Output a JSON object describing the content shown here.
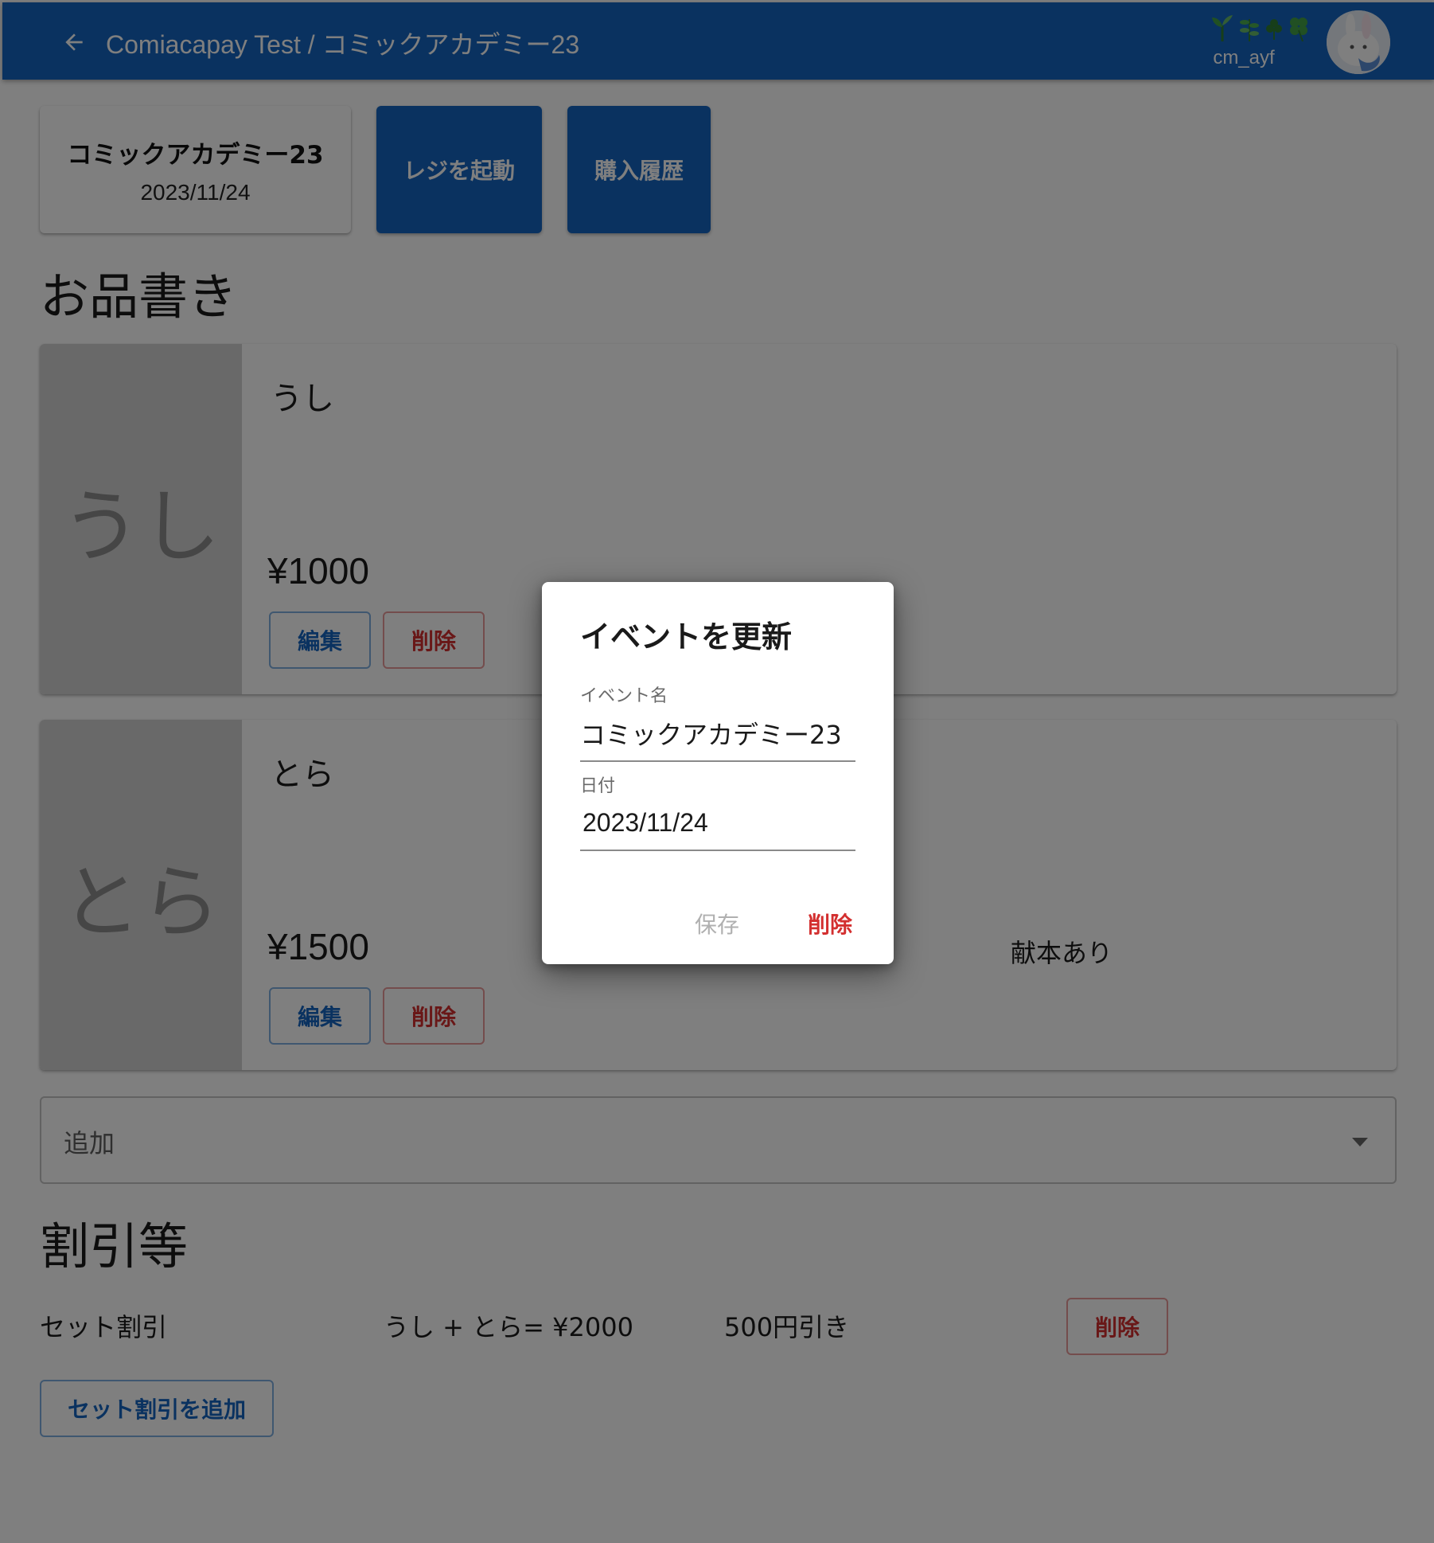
{
  "appbar": {
    "title": "Comiacapay Test / コミックアカデミー23",
    "user_emoji": "🌱🌿☘🍀",
    "username": "cm_ayf",
    "icons": [
      "arrow-left-icon",
      "avatar"
    ]
  },
  "event": {
    "name": "コミックアカデミー23",
    "date": "2023/11/24"
  },
  "actions": {
    "register_label": "レジを起動",
    "history_label": "購入履歴"
  },
  "menu": {
    "title": "お品書き",
    "items": [
      {
        "thumb_text": "うし",
        "name": "うし",
        "price": "¥1000",
        "note": "",
        "edit_label": "編集",
        "delete_label": "削除"
      },
      {
        "thumb_text": "とら",
        "name": "とら",
        "price": "¥1500",
        "note": "献本あり",
        "edit_label": "編集",
        "delete_label": "削除"
      }
    ],
    "add_select_label": "追加"
  },
  "discounts": {
    "title": "割引等",
    "rows": [
      {
        "type": "セット割引",
        "items": "うし + とら= ¥2000",
        "amount": "500円引き",
        "delete_label": "削除"
      }
    ],
    "add_set_label": "セット割引を追加"
  },
  "dialog": {
    "title": "イベントを更新",
    "name_label": "イベント名",
    "name_value": "コミックアカデミー23",
    "date_label": "日付",
    "date_value": "2023/11/24",
    "save_label": "保存",
    "delete_label": "削除"
  },
  "colors": {
    "primary": "#1565c0",
    "danger": "#d32f2f",
    "overlay": "rgba(0,0,0,0.5)"
  }
}
